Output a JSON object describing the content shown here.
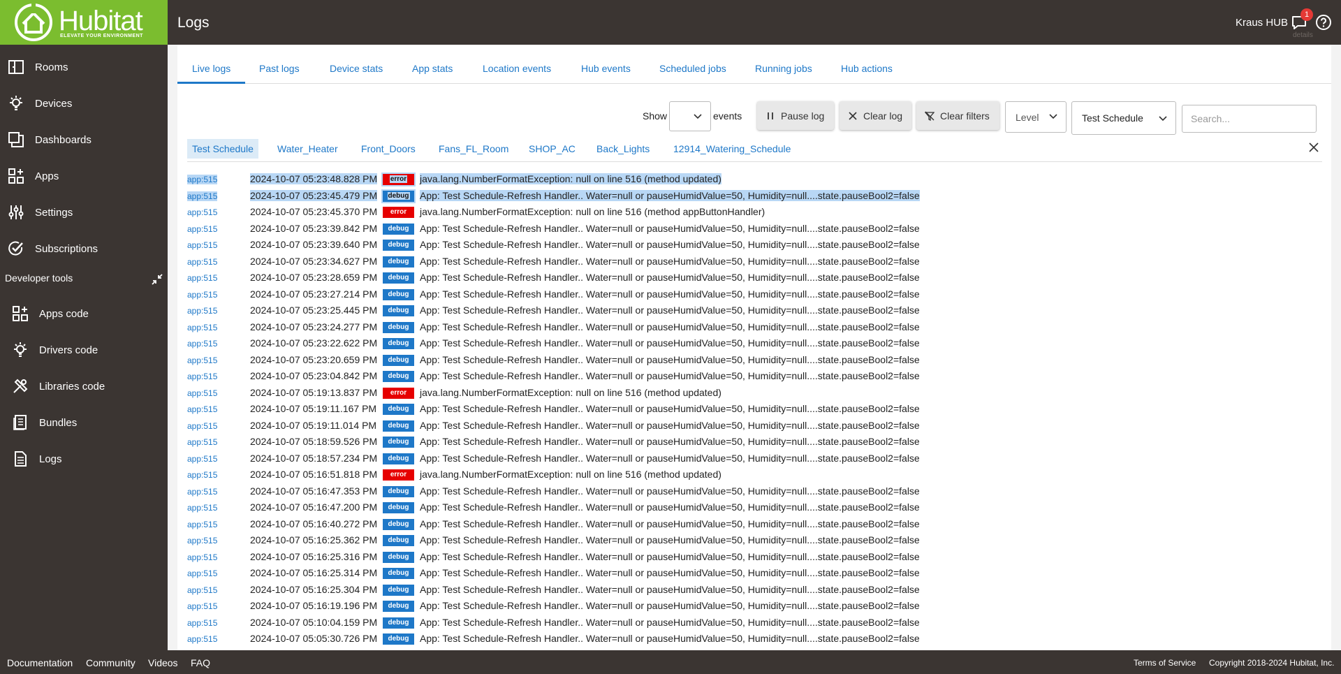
{
  "header": {
    "brand_name": "Hubitat",
    "brand_tagline": "ELEVATE YOUR ENVIRONMENT",
    "page_title": "Logs",
    "hub_name": "Kraus HUB",
    "notification_count": "1",
    "notification_tooltip": "details"
  },
  "sidebar": {
    "items": [
      {
        "label": "Rooms",
        "icon": "rooms-icon"
      },
      {
        "label": "Devices",
        "icon": "bulb-icon"
      },
      {
        "label": "Dashboards",
        "icon": "dashboards-icon"
      },
      {
        "label": "Apps",
        "icon": "apps-icon"
      },
      {
        "label": "Settings",
        "icon": "settings-icon"
      },
      {
        "label": "Subscriptions",
        "icon": "check-circle-icon"
      }
    ],
    "developer_tools_label": "Developer tools",
    "dev_items": [
      {
        "label": "Apps code",
        "icon": "apps-code-icon"
      },
      {
        "label": "Drivers code",
        "icon": "bulb-icon"
      },
      {
        "label": "Libraries code",
        "icon": "tools-icon"
      },
      {
        "label": "Bundles",
        "icon": "bundle-icon"
      },
      {
        "label": "Logs",
        "icon": "document-icon"
      }
    ]
  },
  "tabs": [
    "Live logs",
    "Past logs",
    "Device stats",
    "App stats",
    "Location events",
    "Hub events",
    "Scheduled jobs",
    "Running jobs",
    "Hub actions"
  ],
  "active_tab": "Live logs",
  "toolbar": {
    "show_label": "Show",
    "show_value": "",
    "events_label": "events",
    "pause_label": "Pause log",
    "clear_label": "Clear log",
    "clear_filters_label": "Clear filters",
    "level_value": "Level",
    "app_filter_value": "Test Schedule",
    "search_placeholder": "Search..."
  },
  "filter_chips": [
    "Test Schedule",
    "Water_Heater",
    "Front_Doors",
    "Fans_FL_Room",
    "SHOP_AC",
    "Back_Lights",
    "12914_Watering_Schedule"
  ],
  "colors": {
    "topbar": "#3b3532",
    "brand_green": "#7bbd2f",
    "link_blue": "#1e78c8",
    "debug_badge": "#1e78c8",
    "error_badge": "#e60000",
    "selection": "#b8d7f5"
  },
  "logs": [
    {
      "src": "app:515",
      "time": "2024-10-07 05:23:48.828 PM",
      "level": "error",
      "msg": "java.lang.NumberFormatException: null on line 516 (method updated)",
      "selected": true
    },
    {
      "src": "app:515",
      "time": "2024-10-07 05:23:45.479 PM",
      "level": "debug",
      "msg": "App: Test Schedule-Refresh Handler.. Water=null or pauseHumidValue=50, Humidity=null....state.pauseBool2=false",
      "selected": true
    },
    {
      "src": "app:515",
      "time": "2024-10-07 05:23:45.370 PM",
      "level": "error",
      "msg": "java.lang.NumberFormatException: null on line 516 (method appButtonHandler)",
      "selected": false
    },
    {
      "src": "app:515",
      "time": "2024-10-07 05:23:39.842 PM",
      "level": "debug",
      "msg": "App: Test Schedule-Refresh Handler.. Water=null or pauseHumidValue=50, Humidity=null....state.pauseBool2=false",
      "selected": false
    },
    {
      "src": "app:515",
      "time": "2024-10-07 05:23:39.640 PM",
      "level": "debug",
      "msg": "App: Test Schedule-Refresh Handler.. Water=null or pauseHumidValue=50, Humidity=null....state.pauseBool2=false",
      "selected": false
    },
    {
      "src": "app:515",
      "time": "2024-10-07 05:23:34.627 PM",
      "level": "debug",
      "msg": "App: Test Schedule-Refresh Handler.. Water=null or pauseHumidValue=50, Humidity=null....state.pauseBool2=false",
      "selected": false
    },
    {
      "src": "app:515",
      "time": "2024-10-07 05:23:28.659 PM",
      "level": "debug",
      "msg": "App: Test Schedule-Refresh Handler.. Water=null or pauseHumidValue=50, Humidity=null....state.pauseBool2=false",
      "selected": false
    },
    {
      "src": "app:515",
      "time": "2024-10-07 05:23:27.214 PM",
      "level": "debug",
      "msg": "App: Test Schedule-Refresh Handler.. Water=null or pauseHumidValue=50, Humidity=null....state.pauseBool2=false",
      "selected": false
    },
    {
      "src": "app:515",
      "time": "2024-10-07 05:23:25.445 PM",
      "level": "debug",
      "msg": "App: Test Schedule-Refresh Handler.. Water=null or pauseHumidValue=50, Humidity=null....state.pauseBool2=false",
      "selected": false
    },
    {
      "src": "app:515",
      "time": "2024-10-07 05:23:24.277 PM",
      "level": "debug",
      "msg": "App: Test Schedule-Refresh Handler.. Water=null or pauseHumidValue=50, Humidity=null....state.pauseBool2=false",
      "selected": false
    },
    {
      "src": "app:515",
      "time": "2024-10-07 05:23:22.622 PM",
      "level": "debug",
      "msg": "App: Test Schedule-Refresh Handler.. Water=null or pauseHumidValue=50, Humidity=null....state.pauseBool2=false",
      "selected": false
    },
    {
      "src": "app:515",
      "time": "2024-10-07 05:23:20.659 PM",
      "level": "debug",
      "msg": "App: Test Schedule-Refresh Handler.. Water=null or pauseHumidValue=50, Humidity=null....state.pauseBool2=false",
      "selected": false
    },
    {
      "src": "app:515",
      "time": "2024-10-07 05:23:04.842 PM",
      "level": "debug",
      "msg": "App: Test Schedule-Refresh Handler.. Water=null or pauseHumidValue=50, Humidity=null....state.pauseBool2=false",
      "selected": false
    },
    {
      "src": "app:515",
      "time": "2024-10-07 05:19:13.837 PM",
      "level": "error",
      "msg": "java.lang.NumberFormatException: null on line 516 (method updated)",
      "selected": false
    },
    {
      "src": "app:515",
      "time": "2024-10-07 05:19:11.167 PM",
      "level": "debug",
      "msg": "App: Test Schedule-Refresh Handler.. Water=null or pauseHumidValue=50, Humidity=null....state.pauseBool2=false",
      "selected": false
    },
    {
      "src": "app:515",
      "time": "2024-10-07 05:19:11.014 PM",
      "level": "debug",
      "msg": "App: Test Schedule-Refresh Handler.. Water=null or pauseHumidValue=50, Humidity=null....state.pauseBool2=false",
      "selected": false
    },
    {
      "src": "app:515",
      "time": "2024-10-07 05:18:59.526 PM",
      "level": "debug",
      "msg": "App: Test Schedule-Refresh Handler.. Water=null or pauseHumidValue=50, Humidity=null....state.pauseBool2=false",
      "selected": false
    },
    {
      "src": "app:515",
      "time": "2024-10-07 05:18:57.234 PM",
      "level": "debug",
      "msg": "App: Test Schedule-Refresh Handler.. Water=null or pauseHumidValue=50, Humidity=null....state.pauseBool2=false",
      "selected": false
    },
    {
      "src": "app:515",
      "time": "2024-10-07 05:16:51.818 PM",
      "level": "error",
      "msg": "java.lang.NumberFormatException: null on line 516 (method updated)",
      "selected": false
    },
    {
      "src": "app:515",
      "time": "2024-10-07 05:16:47.353 PM",
      "level": "debug",
      "msg": "App: Test Schedule-Refresh Handler.. Water=null or pauseHumidValue=50, Humidity=null....state.pauseBool2=false",
      "selected": false
    },
    {
      "src": "app:515",
      "time": "2024-10-07 05:16:47.200 PM",
      "level": "debug",
      "msg": "App: Test Schedule-Refresh Handler.. Water=null or pauseHumidValue=50, Humidity=null....state.pauseBool2=false",
      "selected": false
    },
    {
      "src": "app:515",
      "time": "2024-10-07 05:16:40.272 PM",
      "level": "debug",
      "msg": "App: Test Schedule-Refresh Handler.. Water=null or pauseHumidValue=50, Humidity=null....state.pauseBool2=false",
      "selected": false
    },
    {
      "src": "app:515",
      "time": "2024-10-07 05:16:25.362 PM",
      "level": "debug",
      "msg": "App: Test Schedule-Refresh Handler.. Water=null or pauseHumidValue=50, Humidity=null....state.pauseBool2=false",
      "selected": false
    },
    {
      "src": "app:515",
      "time": "2024-10-07 05:16:25.316 PM",
      "level": "debug",
      "msg": "App: Test Schedule-Refresh Handler.. Water=null or pauseHumidValue=50, Humidity=null....state.pauseBool2=false",
      "selected": false
    },
    {
      "src": "app:515",
      "time": "2024-10-07 05:16:25.314 PM",
      "level": "debug",
      "msg": "App: Test Schedule-Refresh Handler.. Water=null or pauseHumidValue=50, Humidity=null....state.pauseBool2=false",
      "selected": false
    },
    {
      "src": "app:515",
      "time": "2024-10-07 05:16:25.304 PM",
      "level": "debug",
      "msg": "App: Test Schedule-Refresh Handler.. Water=null or pauseHumidValue=50, Humidity=null....state.pauseBool2=false",
      "selected": false
    },
    {
      "src": "app:515",
      "time": "2024-10-07 05:16:19.196 PM",
      "level": "debug",
      "msg": "App: Test Schedule-Refresh Handler.. Water=null or pauseHumidValue=50, Humidity=null....state.pauseBool2=false",
      "selected": false
    },
    {
      "src": "app:515",
      "time": "2024-10-07 05:10:04.159 PM",
      "level": "debug",
      "msg": "App: Test Schedule-Refresh Handler.. Water=null or pauseHumidValue=50, Humidity=null....state.pauseBool2=false",
      "selected": false
    },
    {
      "src": "app:515",
      "time": "2024-10-07 05:05:30.726 PM",
      "level": "debug",
      "msg": "App: Test Schedule-Refresh Handler.. Water=null or pauseHumidValue=50, Humidity=null....state.pauseBool2=false",
      "selected": false
    }
  ],
  "footer": {
    "links": [
      "Documentation",
      "Community",
      "Videos",
      "FAQ"
    ],
    "terms_label": "Terms of Service",
    "copyright": "Copyright 2018-2024 Hubitat, Inc."
  }
}
